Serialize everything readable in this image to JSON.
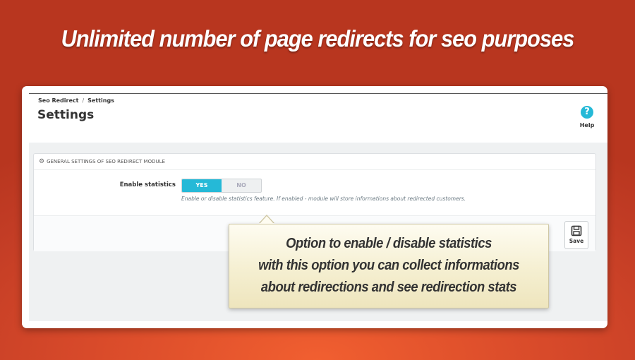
{
  "banner": {
    "headline": "Unlimited number of page redirects for seo purposes"
  },
  "breadcrumb": {
    "items": [
      "Seo Redirect",
      "Settings"
    ],
    "separator": "/"
  },
  "page": {
    "title": "Settings"
  },
  "toolbar": {
    "help_label": "Help",
    "help_icon": "?"
  },
  "panel": {
    "heading": "GENERAL SETTINGS OF SEO REDIRECT MODULE",
    "field_label": "Enable statistics",
    "toggle": {
      "yes_label": "YES",
      "no_label": "NO",
      "selected": "YES"
    },
    "help_text": "Enable or disable statistics feature. If enabled - module will store informations about redirected customers.",
    "save_label": "Save"
  },
  "callout": {
    "lines": [
      "Option to enable / disable statistics",
      "with this option you can collect informations",
      "about redirections and see redirection stats"
    ]
  },
  "colors": {
    "accent": "#25b9d7",
    "background": "#d84a2a"
  }
}
